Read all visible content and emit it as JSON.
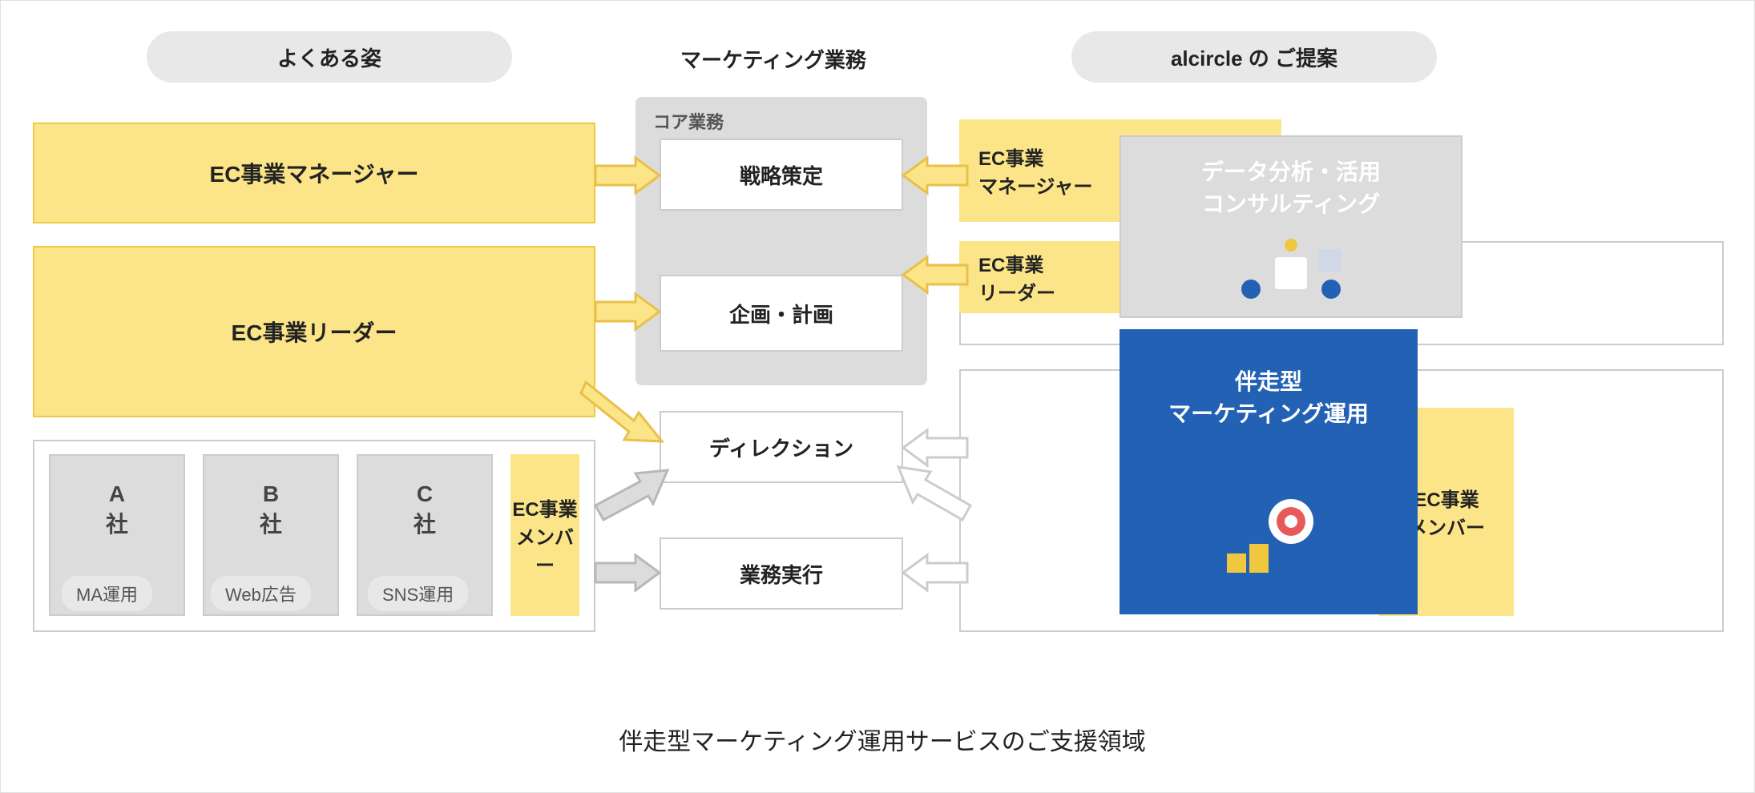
{
  "headers": {
    "left": "よくある姿",
    "center": "マーケティング業務",
    "right": "alcircle の ご提案"
  },
  "core_label": "コア業務",
  "center_boxes": [
    "戦略策定",
    "企画・計画",
    "ディレクション",
    "業務実行"
  ],
  "left": {
    "row1": "EC事業マネージャー",
    "row2": "EC事業リーダー",
    "companies": [
      {
        "name": "A\n社",
        "tag": "MA運用"
      },
      {
        "name": "B\n社",
        "tag": "Web広告"
      },
      {
        "name": "C\n社",
        "tag": "SNS運用"
      }
    ],
    "member": "EC事業\nメンバー"
  },
  "right": {
    "manager": "EC事業\nマネージャー",
    "leader": "EC事業\nリーダー",
    "member": "EC事業\nメンバー",
    "gray_panel": "データ分析・活用\nコンサルティング",
    "blue_panel": "伴走型\nマーケティング運用"
  },
  "footer": "伴走型マーケティング運用サービスのご支援領域"
}
